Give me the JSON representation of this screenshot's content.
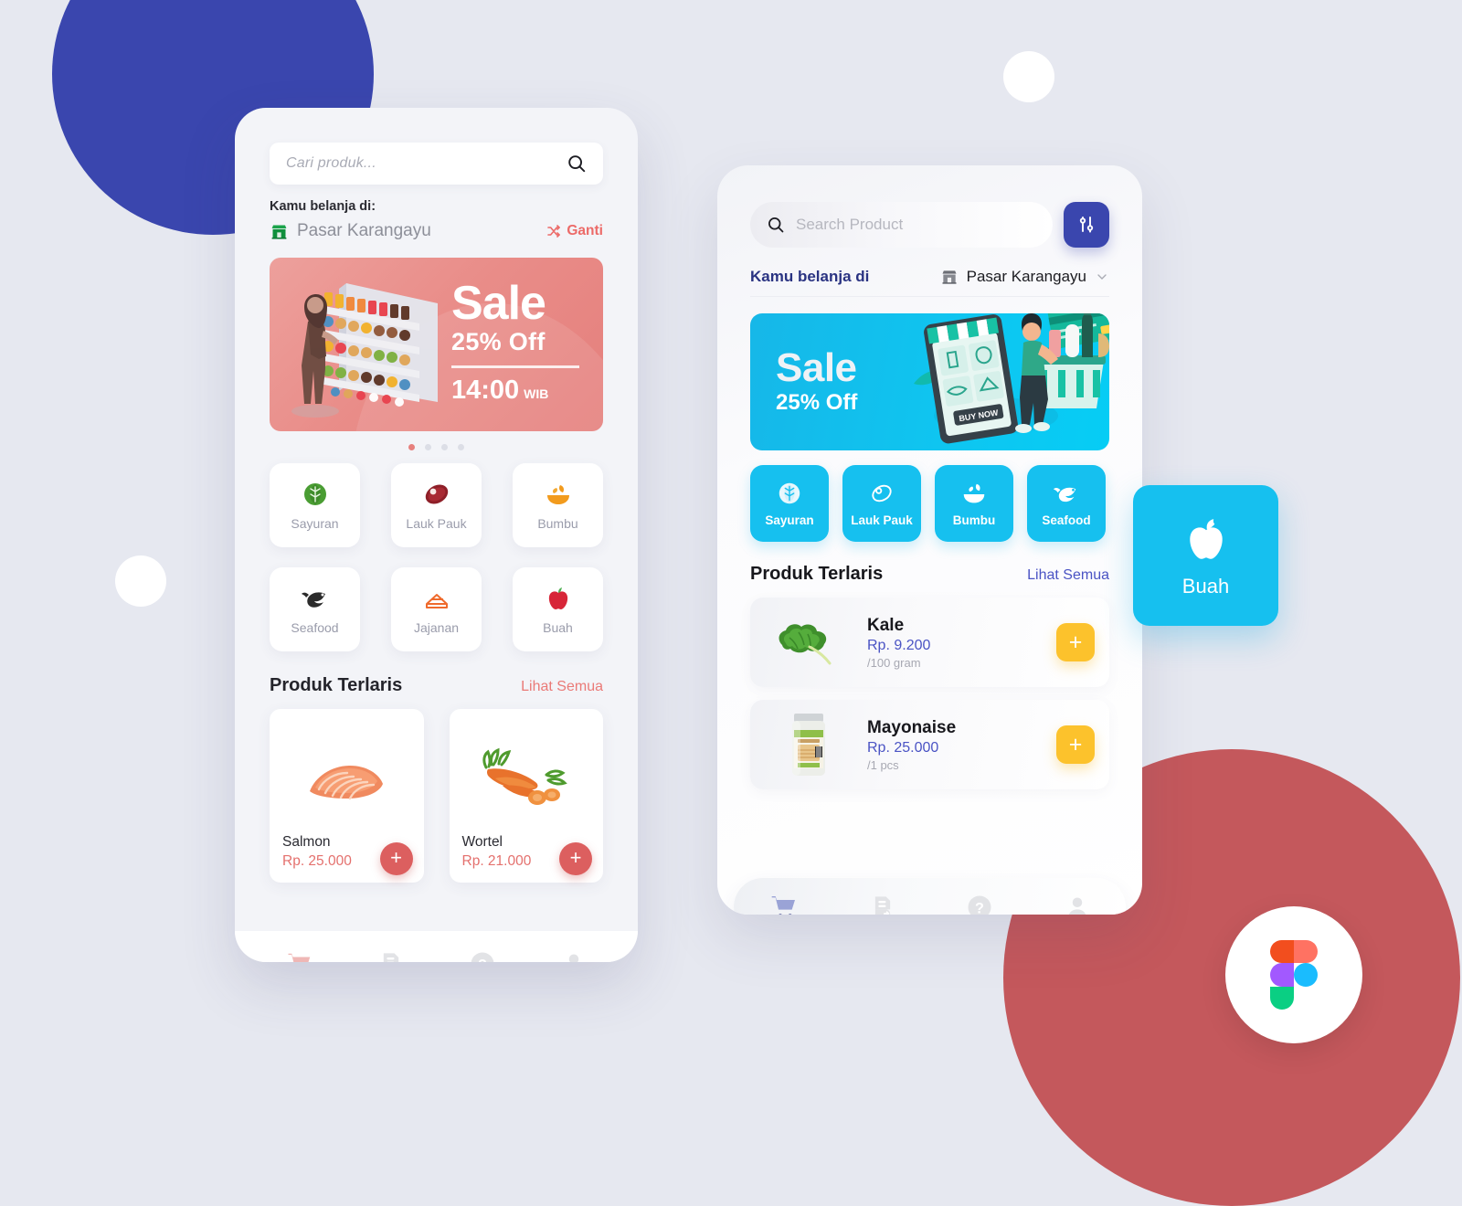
{
  "background": {
    "page_color": "#e6e8f0",
    "blob_blue_color": "#3a46ae",
    "blob_coral_color": "#c4585c",
    "dot_color": "#ffffff"
  },
  "figma_badge": {
    "name": "figma-logo",
    "colors": [
      "#f24e1e",
      "#ff7262",
      "#a259ff",
      "#1abcfe",
      "#0acf83"
    ]
  },
  "left_phone": {
    "search": {
      "placeholder": "Cari produk...",
      "icon": "search-icon"
    },
    "store": {
      "label": "Kamu belanja di:",
      "name": "Pasar Karangayu",
      "store_icon": "store-icon",
      "change_label": "Ganti",
      "change_icon": "shuffle-icon",
      "change_color": "#ec6a68"
    },
    "banner": {
      "title": "Sale",
      "subtitle": "25% Off",
      "time": "14:00",
      "timezone": "WIB",
      "bg_color": "#e98d89"
    },
    "carousel": {
      "total_dots": 4,
      "active_index": 0,
      "active_color": "#e7807d"
    },
    "categories": [
      {
        "label": "Sayuran",
        "icon": "lettuce-icon",
        "color": "#4a9d33"
      },
      {
        "label": "Lauk Pauk",
        "icon": "steak-icon",
        "color": "#8e1f28"
      },
      {
        "label": "Bumbu",
        "icon": "spice-bowl-icon",
        "color": "#f29b1d"
      },
      {
        "label": "Seafood",
        "icon": "shrimp-icon",
        "color": "#2b2b2b"
      },
      {
        "label": "Jajanan",
        "icon": "cake-slice-icon",
        "color": "#ef6a2c"
      },
      {
        "label": "Buah",
        "icon": "apple-icon",
        "color": "#d72638"
      }
    ],
    "section": {
      "title": "Produk Terlaris",
      "link": "Lihat Semua",
      "link_color": "#ea7a77"
    },
    "products": [
      {
        "name": "Salmon",
        "price": "Rp. 25.000",
        "image": "salmon-photo",
        "add_label": "+"
      },
      {
        "name": "Wortel",
        "price": "Rp. 21.000",
        "image": "carrot-photo",
        "add_label": "+"
      }
    ],
    "tabbar": [
      {
        "name": "cart-tab",
        "icon": "shopping-cart-icon",
        "active": true,
        "color": "#efb7b5"
      },
      {
        "name": "orders-tab",
        "icon": "receipt-icon",
        "active": false,
        "color": "#e2e3e6"
      },
      {
        "name": "help-tab",
        "icon": "question-circle-icon",
        "active": false,
        "color": "#e2e3e6"
      },
      {
        "name": "profile-tab",
        "icon": "person-icon",
        "active": false,
        "color": "#e2e3e6"
      }
    ]
  },
  "right_phone": {
    "search": {
      "placeholder": "Search Product",
      "icon": "search-icon"
    },
    "filter_button": {
      "icon": "sliders-icon",
      "color": "#3a46ae"
    },
    "store": {
      "label": "Kamu belanja di",
      "name": "Pasar Karangayu",
      "store_icon": "store-icon",
      "chevron_icon": "chevron-down-icon",
      "label_color": "#2a3382"
    },
    "banner": {
      "title": "Sale",
      "subtitle": "25% Off",
      "bg_color": "#0fc5f0",
      "illustration": "man-shopping-phone-illustration"
    },
    "categories": [
      {
        "label": "Sayuran",
        "icon": "lettuce-icon"
      },
      {
        "label": "Lauk Pauk",
        "icon": "steak-icon"
      },
      {
        "label": "Bumbu",
        "icon": "spice-bowl-icon"
      },
      {
        "label": "Seafood",
        "icon": "shrimp-icon"
      }
    ],
    "section": {
      "title": "Produk Terlaris",
      "link": "Lihat Semua",
      "link_color": "#4a53c4"
    },
    "products": [
      {
        "name": "Kale",
        "price": "Rp. 9.200",
        "unit": "/100 gram",
        "image": "kale-photo",
        "add_label": "+"
      },
      {
        "name": "Mayonaise",
        "price": "Rp. 25.000",
        "unit": "/1 pcs",
        "image": "mayonnaise-photo",
        "add_label": "+"
      }
    ],
    "tabbar": [
      {
        "name": "cart-tab",
        "icon": "shopping-cart-icon",
        "active": true,
        "color": "#9aa3d6"
      },
      {
        "name": "orders-tab",
        "icon": "receipt-icon",
        "active": false,
        "color": "#e2e3e6"
      },
      {
        "name": "help-tab",
        "icon": "question-circle-icon",
        "active": false,
        "color": "#e2e3e6"
      },
      {
        "name": "profile-tab",
        "icon": "person-icon",
        "active": false,
        "color": "#e2e3e6"
      }
    ],
    "home_indicator_color": "#fcc22c"
  },
  "floating_card": {
    "label": "Buah",
    "icon": "apple-icon",
    "bg_color": "#16c0ef"
  }
}
